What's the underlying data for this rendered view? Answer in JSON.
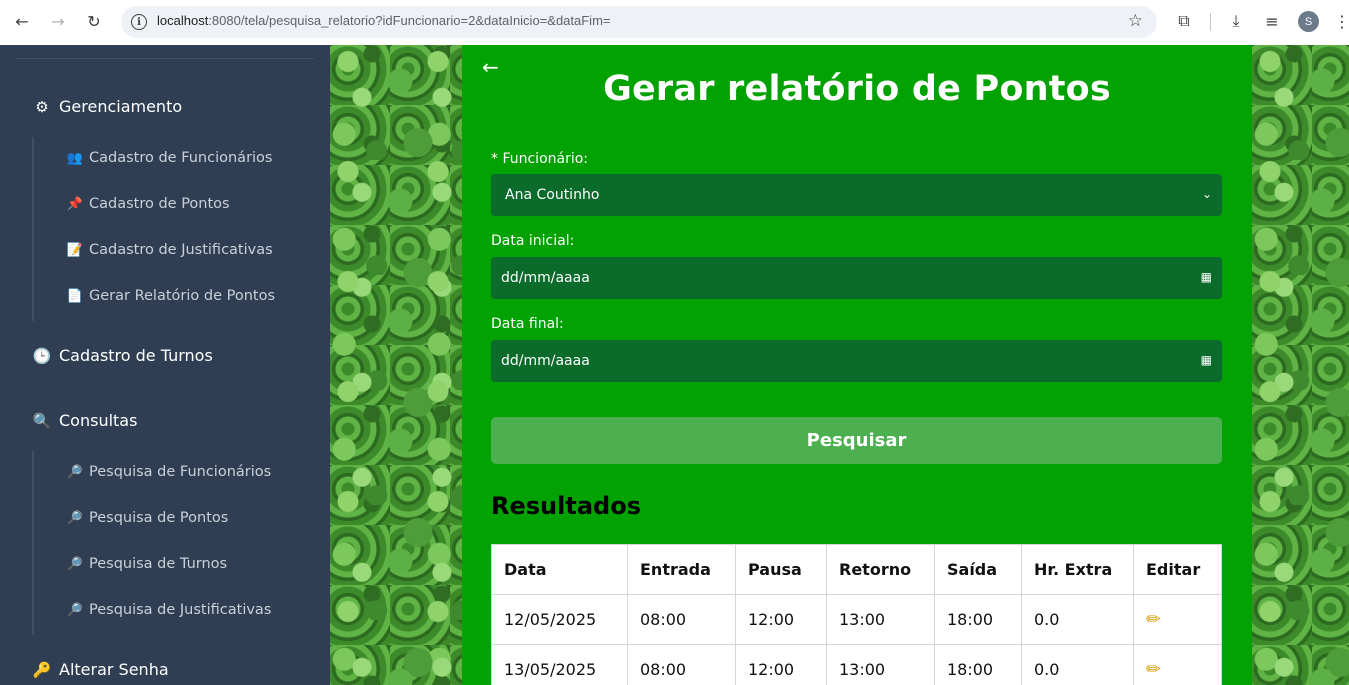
{
  "browser": {
    "url_host": "localhost",
    "url_rest": ":8080/tela/pesquisa_relatorio?idFuncionario=2&dataInicio=&dataFim=",
    "avatar_initial": "S"
  },
  "sidebar": {
    "sections": [
      {
        "title": "Gerenciamento",
        "icon": "gear-icon",
        "glyph": "⚙"
      },
      {
        "title": "Cadastro de Turnos",
        "icon": "clock-icon",
        "glyph": "🕒"
      },
      {
        "title": "Consultas",
        "icon": "magnifier-icon",
        "glyph": "🔍"
      },
      {
        "title": "Alterar Senha",
        "icon": "key-icon",
        "glyph": "🔑"
      }
    ],
    "gerenciamento_items": [
      {
        "label": "Cadastro de Funcionários",
        "icon": "people-icon",
        "glyph": "👥"
      },
      {
        "label": "Cadastro de Pontos",
        "icon": "pin-icon",
        "glyph": "📌"
      },
      {
        "label": "Cadastro de Justificativas",
        "icon": "memo-icon",
        "glyph": "📝"
      },
      {
        "label": "Gerar Relatório de Pontos",
        "icon": "document-icon",
        "glyph": "📄"
      }
    ],
    "consultas_items": [
      {
        "label": "Pesquisa de Funcionários",
        "icon": "search-icon",
        "glyph": "🔎"
      },
      {
        "label": "Pesquisa de Pontos",
        "icon": "search-icon",
        "glyph": "🔎"
      },
      {
        "label": "Pesquisa de Turnos",
        "icon": "search-icon",
        "glyph": "🔎"
      },
      {
        "label": "Pesquisa de Justificativas",
        "icon": "search-icon",
        "glyph": "🔎"
      }
    ]
  },
  "main": {
    "title": "Gerar relatório de Pontos",
    "funcionario_label": "* Funcionário:",
    "funcionario_value": "Ana Coutinho",
    "data_inicial_label": "Data inicial:",
    "data_inicial_value": "dd/mm/aaaa",
    "data_final_label": "Data final:",
    "data_final_value": "dd/mm/aaaa",
    "search_button": "Pesquisar",
    "results_title": "Resultados",
    "table": {
      "headers": [
        "Data",
        "Entrada",
        "Pausa",
        "Retorno",
        "Saída",
        "Hr. Extra",
        "Editar"
      ],
      "rows": [
        [
          "12/05/2025",
          "08:00",
          "12:00",
          "13:00",
          "18:00",
          "0.0"
        ],
        [
          "13/05/2025",
          "08:00",
          "12:00",
          "13:00",
          "18:00",
          "0.0"
        ]
      ]
    }
  },
  "colors": {
    "panel": "#01a201",
    "field": "#0a6b2a",
    "button": "#4caf50",
    "sidebar": "#2f3e52"
  }
}
